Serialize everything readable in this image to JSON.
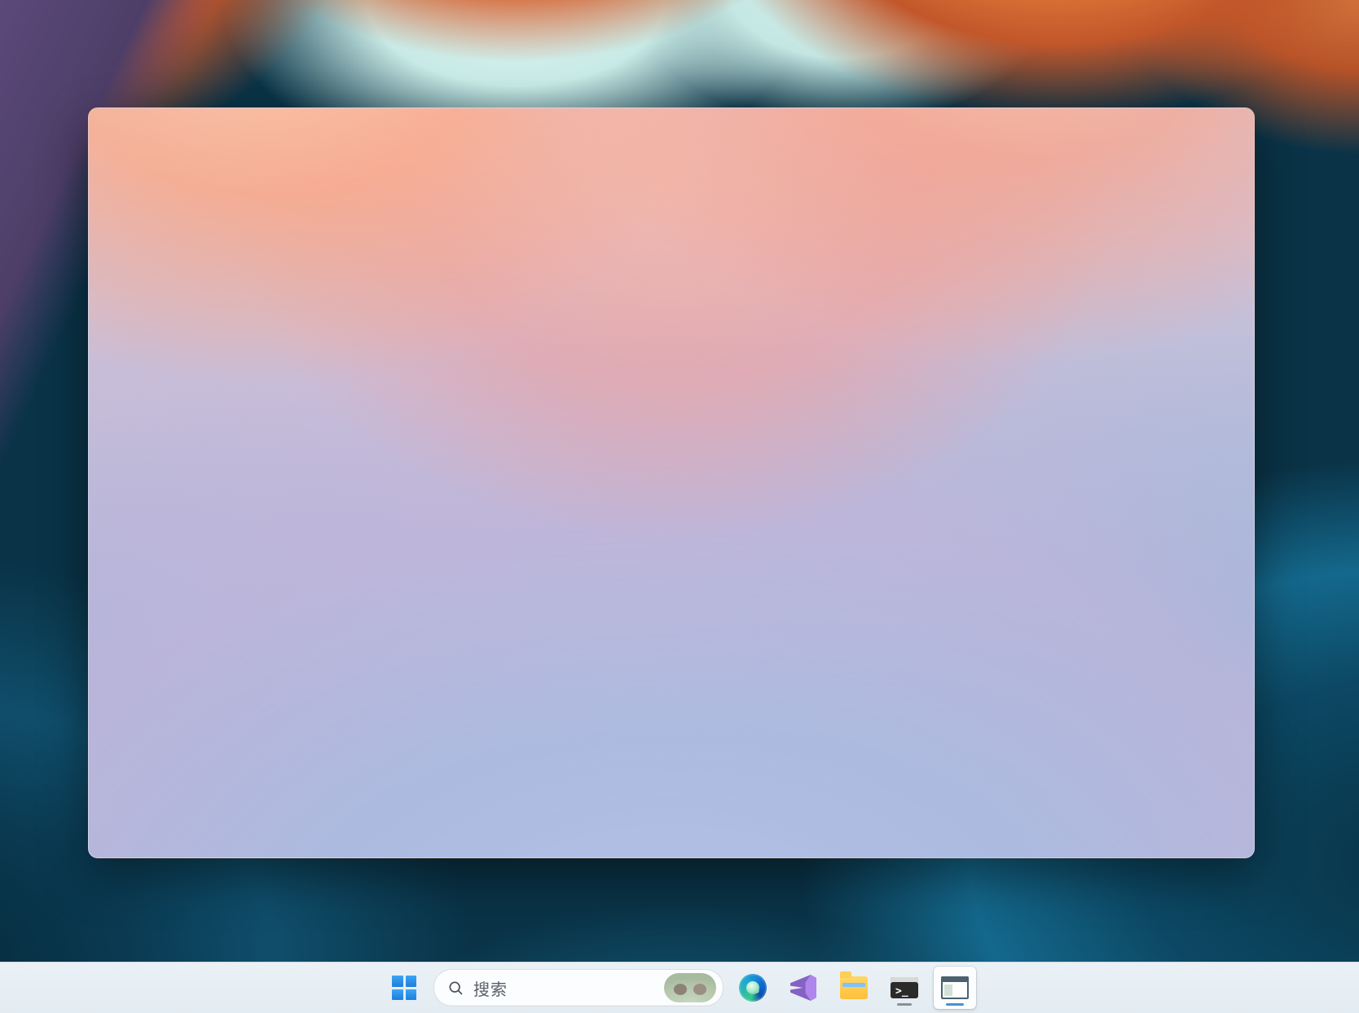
{
  "taskbar": {
    "search_placeholder": "搜索",
    "items": {
      "start": {
        "name": "start-button"
      },
      "search": {
        "name": "taskbar-search"
      },
      "edge": {
        "name": "microsoft-edge"
      },
      "visualstudio": {
        "name": "visual-studio"
      },
      "explorer": {
        "name": "file-explorer"
      },
      "terminal": {
        "name": "terminal"
      },
      "activeapp": {
        "name": "foreground-app"
      }
    }
  }
}
